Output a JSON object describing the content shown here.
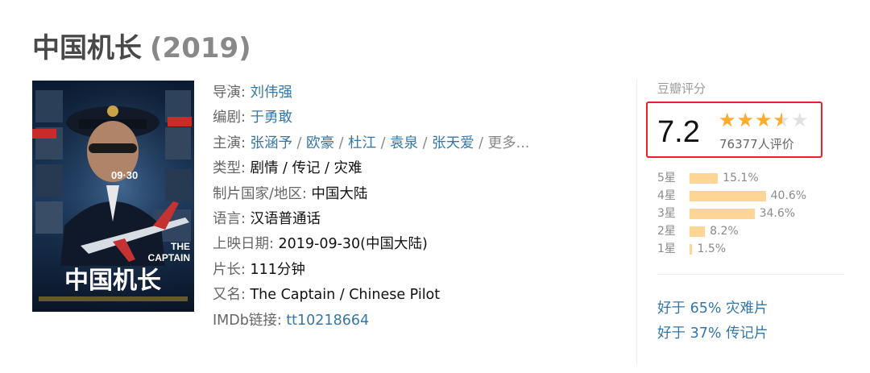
{
  "title": {
    "name": "中国机长",
    "year": "(2019)"
  },
  "poster": {
    "alt_title_line1": "THE",
    "alt_title_line2": "CAPTAIN",
    "cn_title": "中国机长",
    "release_tag": "09·30"
  },
  "info": {
    "director_label": "导演",
    "director": "刘伟强",
    "writer_label": "编剧",
    "writer": "于勇敢",
    "cast_label": "主演",
    "cast": [
      "张涵予",
      "欧豪",
      "杜江",
      "袁泉",
      "张天爱"
    ],
    "cast_more": "更多...",
    "genre_label": "类型",
    "genre": "剧情 / 传记 / 灾难",
    "country_label": "制片国家/地区",
    "country": "中国大陆",
    "language_label": "语言",
    "language": "汉语普通话",
    "release_label": "上映日期",
    "release": "2019-09-30(中国大陆)",
    "runtime_label": "片长",
    "runtime": "111分钟",
    "aka_label": "又名",
    "aka": "The Captain / Chinese Pilot",
    "imdb_label": "IMDb链接",
    "imdb": "tt10218664"
  },
  "rating": {
    "panel_title": "豆瓣评分",
    "score": "7.2",
    "stars_value": 3.5,
    "stars_max": 5,
    "votes": "76377人评价",
    "highlight_color": "#e8222d",
    "star_color": "#ffac2d",
    "bar_color": "#ffd596",
    "distribution": [
      {
        "label": "5星",
        "percent": 15.1,
        "text": "15.1%"
      },
      {
        "label": "4星",
        "percent": 40.6,
        "text": "40.6%"
      },
      {
        "label": "3星",
        "percent": 34.6,
        "text": "34.6%"
      },
      {
        "label": "2星",
        "percent": 8.2,
        "text": "8.2%"
      },
      {
        "label": "1星",
        "percent": 1.5,
        "text": "1.5%"
      }
    ]
  },
  "better_than": [
    {
      "text": "好于 65% 灾难片"
    },
    {
      "text": "好于 37% 传记片"
    }
  ]
}
